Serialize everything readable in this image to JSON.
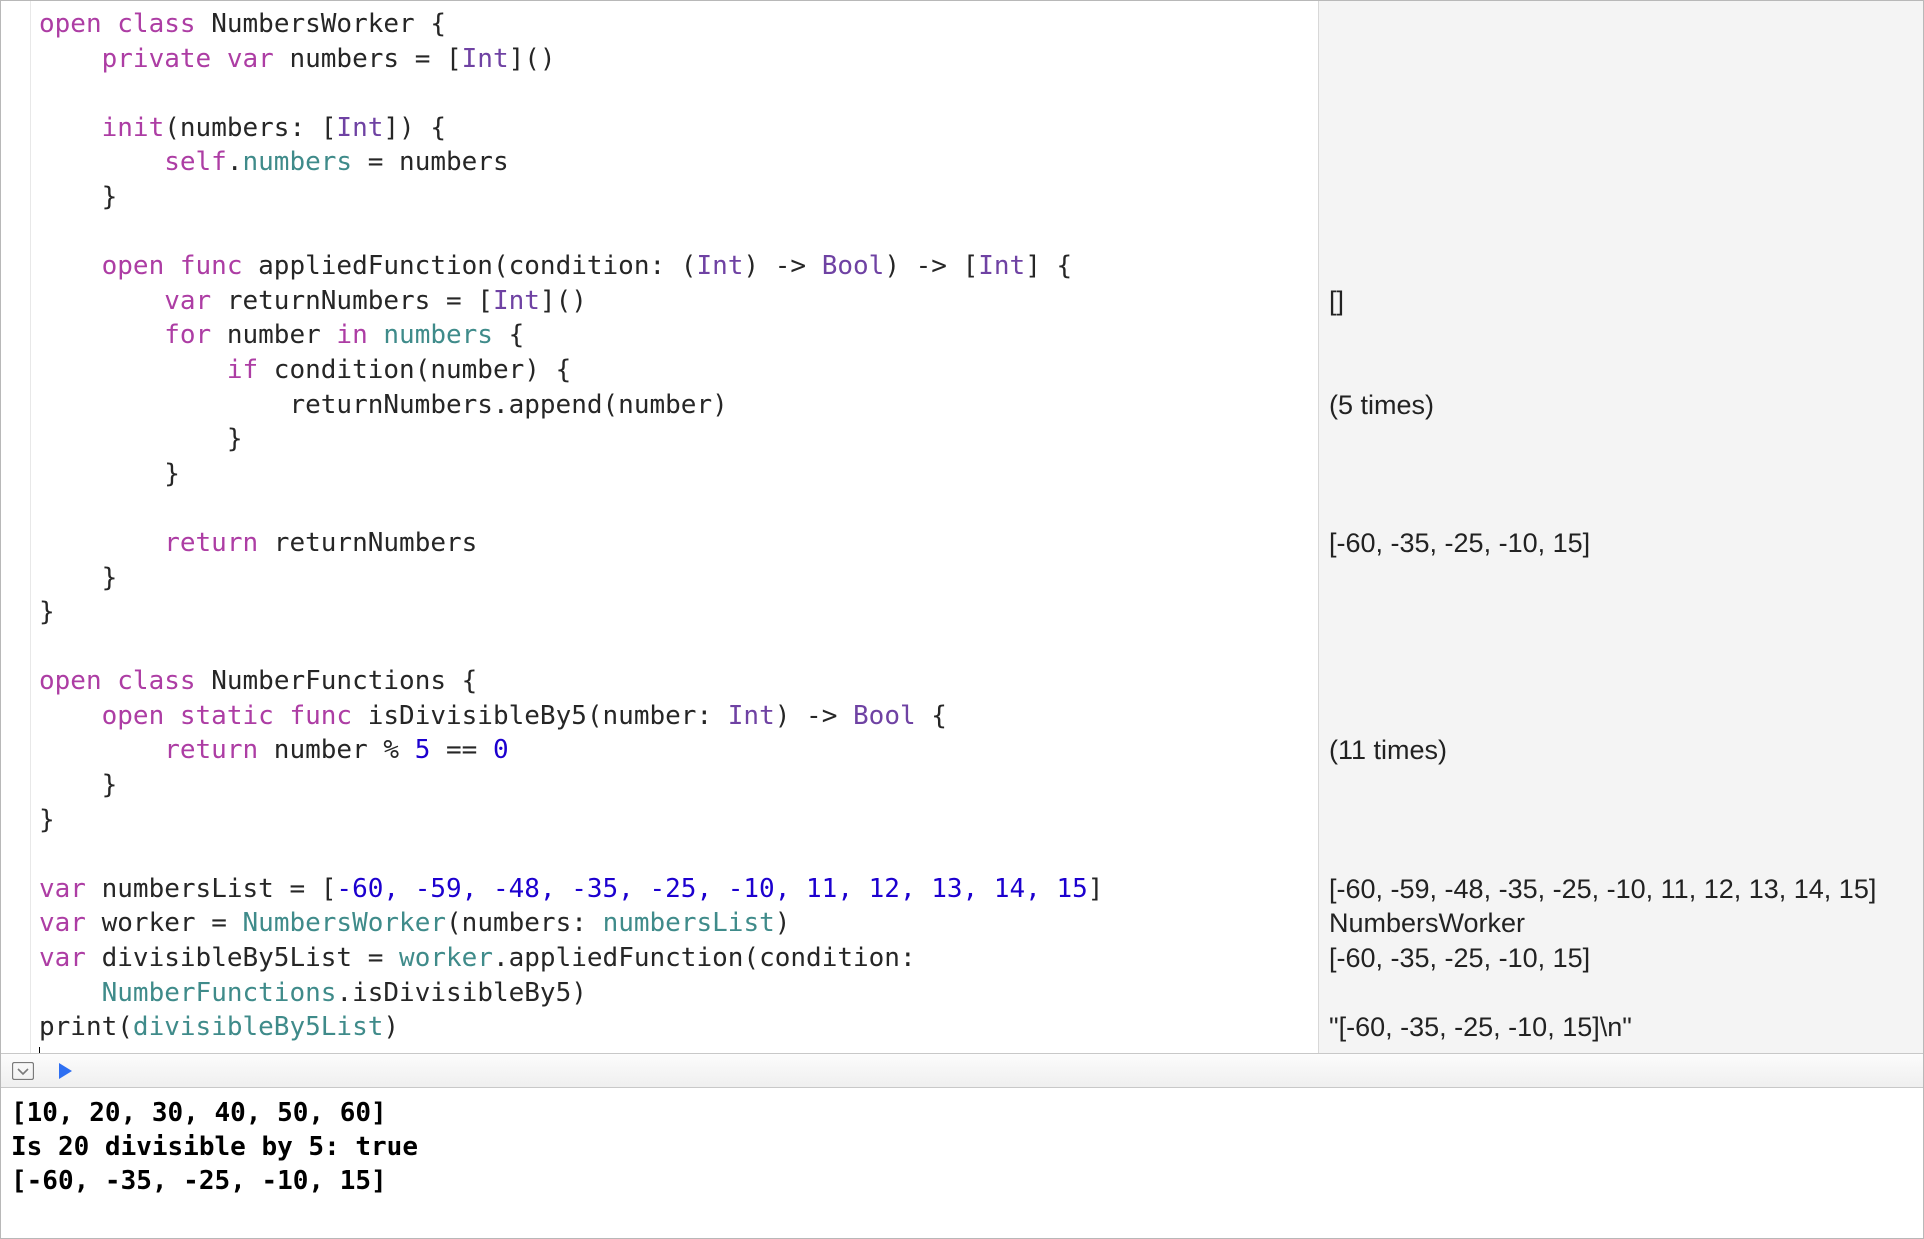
{
  "code": {
    "l1": {
      "a": "open class",
      "b": " NumbersWorker {"
    },
    "l2": {
      "a": "    private var",
      "b": " numbers = [",
      "c": "Int",
      "d": "]()"
    },
    "l3": "",
    "l4": {
      "a": "    init",
      "b": "(numbers: [",
      "c": "Int",
      "d": "]) {"
    },
    "l5": {
      "a": "        self",
      "b": ".",
      "c": "numbers",
      "d": " = numbers"
    },
    "l6": "    }",
    "l7": "",
    "l8": {
      "a": "    open func",
      "b": " appliedFunction(condition: (",
      "c": "Int",
      "d": ") -> ",
      "e": "Bool",
      "f": ") -> [",
      "g": "Int",
      "h": "] {"
    },
    "l9": {
      "a": "        var",
      "b": " returnNumbers = [",
      "c": "Int",
      "d": "]()"
    },
    "l10": {
      "a": "        for",
      "b": " number ",
      "c": "in",
      "d": " ",
      "e": "numbers",
      "f": " {"
    },
    "l11": {
      "a": "            if",
      "b": " condition(number) {"
    },
    "l12": "                returnNumbers.append(number)",
    "l13": "            }",
    "l14": "        }",
    "l15": "",
    "l16": {
      "a": "        return",
      "b": " returnNumbers"
    },
    "l17": "    }",
    "l18": "}",
    "l19": "",
    "l20": {
      "a": "open class",
      "b": " NumberFunctions {"
    },
    "l21": {
      "a": "    open static func",
      "b": " isDivisibleBy5(number: ",
      "c": "Int",
      "d": ") -> ",
      "e": "Bool",
      "f": " {"
    },
    "l22": {
      "a": "        return",
      "b": " number % ",
      "c": "5",
      "d": " == ",
      "e": "0"
    },
    "l23": "    }",
    "l24": "}",
    "l25": "",
    "l26": {
      "a": "var",
      "b": " numbersList = [",
      "nums": "-60, -59, -48, -35, -25, -10, 11, 12, 13, 14, 15",
      "c": "]"
    },
    "l27": {
      "a": "var",
      "b": " worker = ",
      "c": "NumbersWorker",
      "d": "(numbers: ",
      "e": "numbersList",
      "f": ")"
    },
    "l28": {
      "a": "var",
      "b": " divisibleBy5List = ",
      "c": "worker",
      "d": ".appliedFunction(condition: "
    },
    "l29": {
      "a": "    ",
      "b": "NumberFunctions",
      "c": ".isDivisibleBy5)"
    },
    "l30": {
      "a": "print(",
      "b": "divisibleBy5List",
      "c": ")"
    }
  },
  "results": {
    "r9": "[]",
    "r12": "(5 times)",
    "r16": "[-60, -35, -25, -10, 15]",
    "r22": "(11 times)",
    "r26": "[-60, -59, -48, -35, -25, -10, 11, 12, 13, 14, 15]",
    "r27": "NumbersWorker",
    "r28": "[-60, -35, -25, -10, 15]",
    "r30": "\"[-60, -35, -25, -10, 15]\\n\""
  },
  "console": {
    "line1": "[10, 20, 30, 40, 50, 60]",
    "line2": "Is 20 divisible by 5: true",
    "line3": "[-60, -35, -25, -10, 15]"
  },
  "toolbar": {
    "toggle_label": "toggle-results",
    "run_label": "run-playground"
  }
}
